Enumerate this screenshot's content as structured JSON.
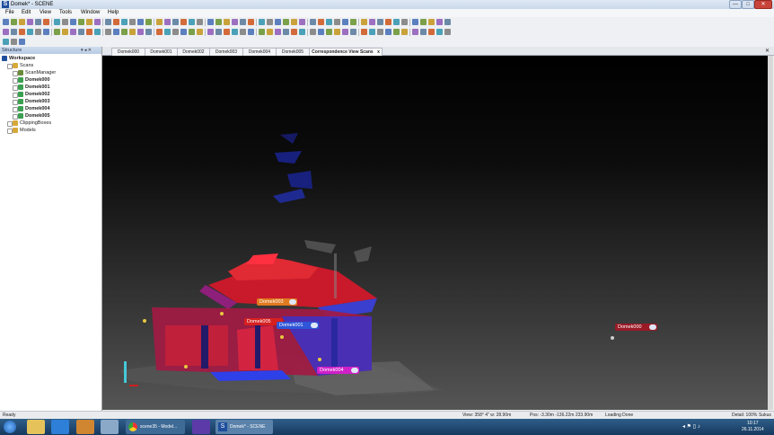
{
  "window": {
    "title": "Domek* - SCENE",
    "logo": "S",
    "buttons": [
      "—",
      "□",
      "✕"
    ]
  },
  "menu": [
    "File",
    "Edit",
    "View",
    "Tools",
    "Window",
    "Help"
  ],
  "structure_panel": {
    "title": "Structure",
    "tree": [
      {
        "label": "Workspace",
        "bold": true,
        "indent": 0,
        "icon": "workspace-icon"
      },
      {
        "label": "Scans",
        "bold": false,
        "indent": 1,
        "icon": "scans-folder-icon"
      },
      {
        "label": "ScanManager",
        "bold": false,
        "indent": 2,
        "icon": "scan-manager-icon"
      },
      {
        "label": "Domek000",
        "bold": true,
        "indent": 2,
        "icon": "scan-icon"
      },
      {
        "label": "Domek001",
        "bold": true,
        "indent": 2,
        "icon": "scan-icon"
      },
      {
        "label": "Domek002",
        "bold": true,
        "indent": 2,
        "icon": "scan-icon"
      },
      {
        "label": "Domek003",
        "bold": true,
        "indent": 2,
        "icon": "scan-icon"
      },
      {
        "label": "Domek004",
        "bold": true,
        "indent": 2,
        "icon": "scan-icon"
      },
      {
        "label": "Domek005",
        "bold": true,
        "indent": 2,
        "icon": "scan-icon"
      },
      {
        "label": "ClippingBoxes",
        "bold": false,
        "indent": 1,
        "icon": "folder-icon"
      },
      {
        "label": "Models",
        "bold": false,
        "indent": 1,
        "icon": "folder-icon"
      }
    ]
  },
  "tabs": [
    "Domek000",
    "Domek001",
    "Domek002",
    "Domek003",
    "Domek004",
    "Domek005",
    "Correspondence View Scans"
  ],
  "active_tab": "Correspondence View Scans",
  "tab_close": "x",
  "scan_labels": [
    "Domek003",
    "Domek005",
    "Domek001",
    "Domek004",
    "Domek000"
  ],
  "statusbar": {
    "left": "Ready",
    "view": "View: 358° 4\" w: 28.90m",
    "pos": "Pos: -3.30m -136.22m 233.90m",
    "loading": "Loading Done",
    "detail": "Detail: 100%",
    "lang": "Sukus"
  },
  "taskbar": {
    "items": [
      {
        "label": "",
        "icon": "explorer-icon"
      },
      {
        "label": "",
        "icon": "ie-icon"
      },
      {
        "label": "",
        "icon": "media-icon"
      },
      {
        "label": "",
        "icon": "paint-icon"
      },
      {
        "label": "scene35 - Model...",
        "icon": "chrome-icon"
      },
      {
        "label": "",
        "icon": "save-icon"
      },
      {
        "label": "Domek* - SCENE",
        "icon": "scene-icon"
      }
    ],
    "time": "10:17",
    "date": "26.11.2014"
  },
  "colors": {
    "accent": "#1e4e9c",
    "point_red": "#e0202a",
    "point_blue": "#2b3fe0"
  }
}
